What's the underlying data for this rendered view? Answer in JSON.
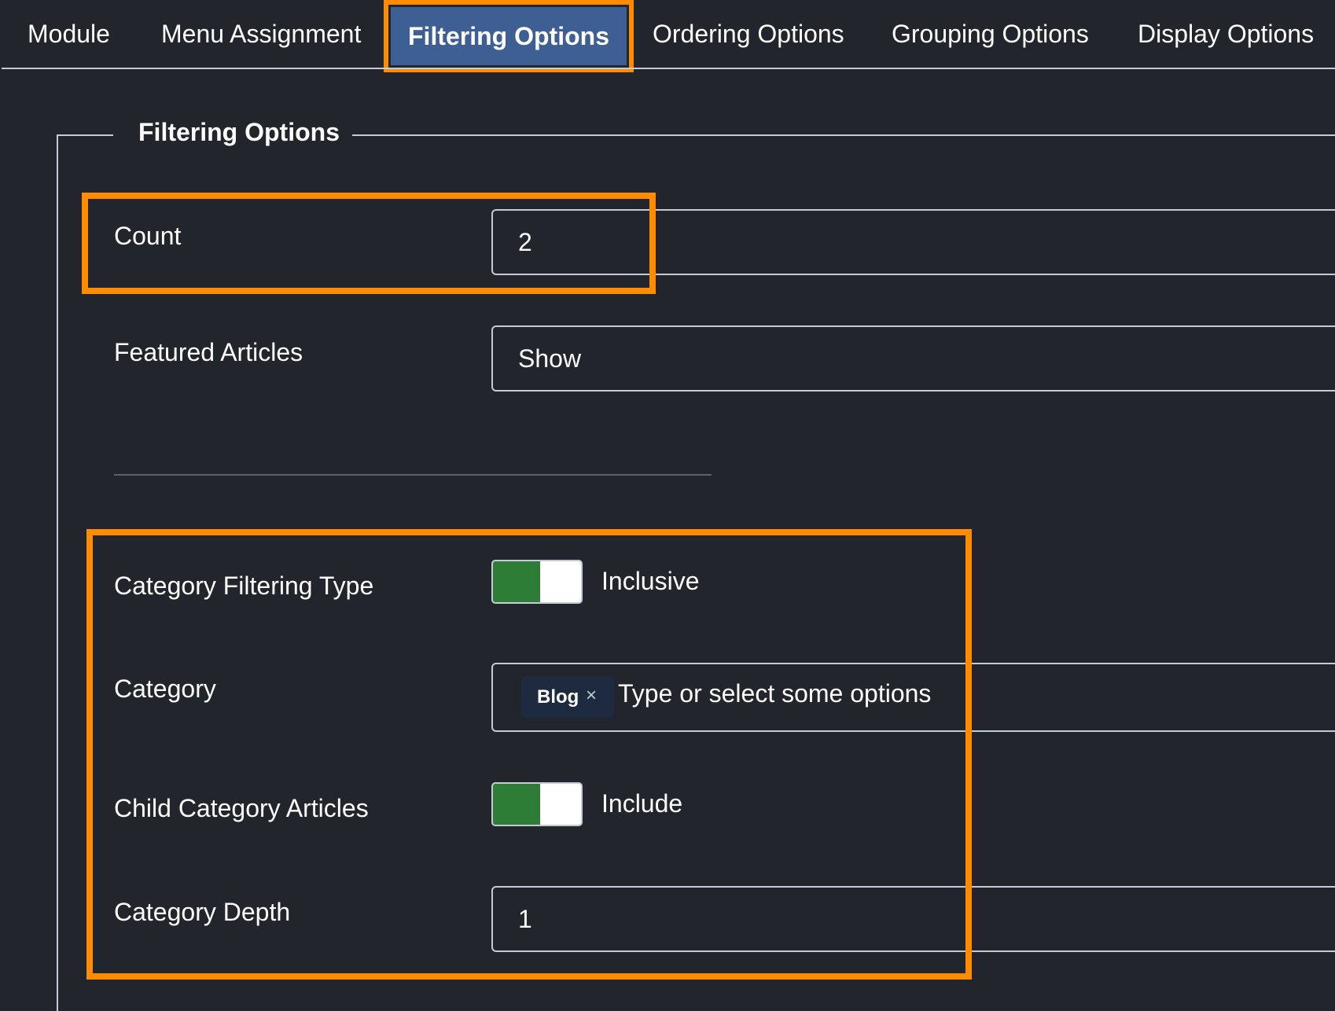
{
  "tabs": [
    {
      "label": "Module"
    },
    {
      "label": "Menu Assignment"
    },
    {
      "label": "Filtering Options"
    },
    {
      "label": "Ordering Options"
    },
    {
      "label": "Grouping Options"
    },
    {
      "label": "Display Options"
    }
  ],
  "fieldset": {
    "legend": "Filtering Options",
    "count": {
      "label": "Count",
      "value": "2"
    },
    "featured": {
      "label": "Featured Articles",
      "value": "Show"
    },
    "category_filtering_type": {
      "label": "Category Filtering Type",
      "state_label": "Inclusive"
    },
    "category": {
      "label": "Category",
      "chip": "Blog",
      "chip_remove": "×",
      "placeholder": "Type or select some options"
    },
    "child_category_articles": {
      "label": "Child Category Articles",
      "state_label": "Include"
    },
    "category_depth": {
      "label": "Category Depth",
      "value": "1"
    }
  },
  "colors": {
    "background": "#22252c",
    "active_tab": "#3e5f93",
    "highlight": "#ff8c00",
    "toggle_on": "#2e7d37"
  }
}
